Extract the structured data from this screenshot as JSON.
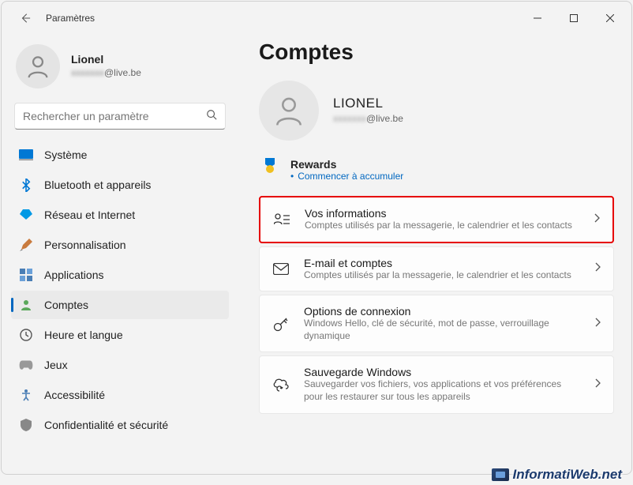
{
  "titlebar": {
    "app_title": "Paramètres"
  },
  "user": {
    "name": "Lionel",
    "email_blur": "xxxxxxx",
    "email_suffix": "@live.be"
  },
  "search": {
    "placeholder": "Rechercher un paramètre"
  },
  "nav": {
    "system": "Système",
    "bluetooth": "Bluetooth et appareils",
    "network": "Réseau et Internet",
    "personalization": "Personnalisation",
    "apps": "Applications",
    "accounts": "Comptes",
    "time": "Heure et langue",
    "gaming": "Jeux",
    "accessibility": "Accessibilité",
    "privacy": "Confidentialité et sécurité"
  },
  "page": {
    "title": "Comptes",
    "account_name": "LIONEL",
    "account_email_blur": "xxxxxxx",
    "account_email_suffix": "@live.be"
  },
  "rewards": {
    "title": "Rewards",
    "sub": "Commencer à accumuler"
  },
  "cards": {
    "info": {
      "title": "Vos informations",
      "sub": "Comptes utilisés par la messagerie, le calendrier et les contacts"
    },
    "email": {
      "title": "E-mail et comptes",
      "sub": "Comptes utilisés par la messagerie, le calendrier et les contacts"
    },
    "signin": {
      "title": "Options de connexion",
      "sub": "Windows Hello, clé de sécurité, mot de passe, verrouillage dynamique"
    },
    "backup": {
      "title": "Sauvegarde Windows",
      "sub": "Sauvegarder vos fichiers, vos applications et vos préférences pour les restaurer sur tous les appareils"
    }
  },
  "watermark": "InformatiWeb.net"
}
